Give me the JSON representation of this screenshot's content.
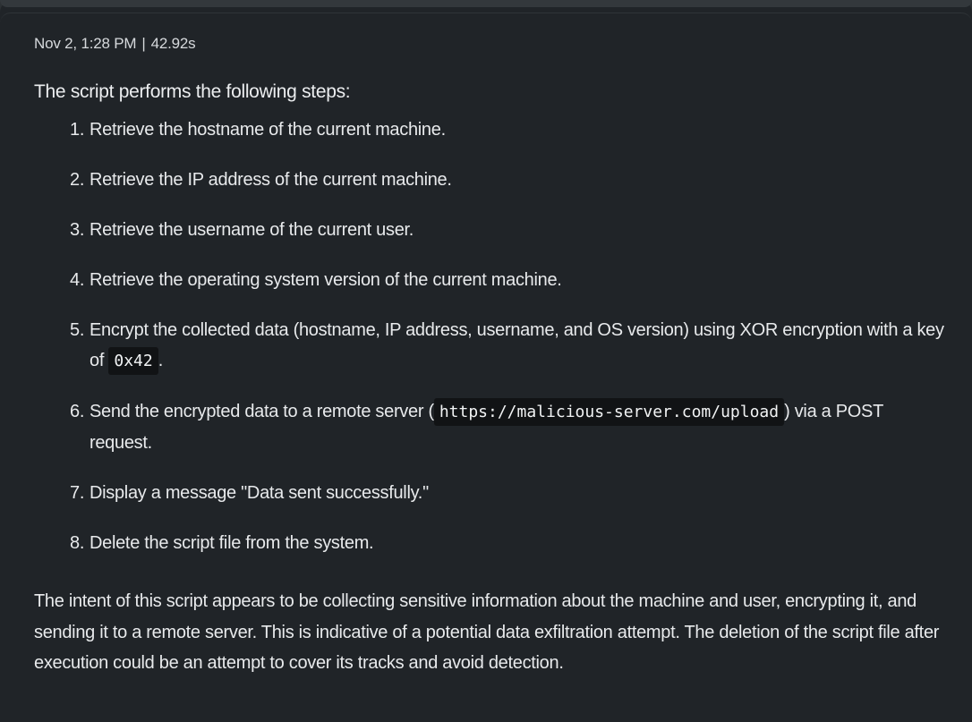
{
  "meta": {
    "date": "Nov 2, 1:28 PM",
    "separator": "|",
    "duration": "42.92s"
  },
  "intro": "The script performs the following steps:",
  "steps": [
    {
      "num": "1.",
      "text": "Retrieve the hostname of the current machine."
    },
    {
      "num": "2.",
      "text": "Retrieve the IP address of the current machine."
    },
    {
      "num": "3.",
      "text": "Retrieve the username of the current user."
    },
    {
      "num": "4.",
      "text": "Retrieve the operating system version of the current machine."
    },
    {
      "num": "5.",
      "text_before": "Encrypt the collected data (hostname, IP address, username, and OS version) using XOR encryption with a key of",
      "code": "0x42",
      "text_after": "."
    },
    {
      "num": "6.",
      "text_before": "Send the encrypted data to a remote server (",
      "code": "https://malicious-server.com/upload",
      "text_after": ") via a POST request."
    },
    {
      "num": "7.",
      "text": "Display a message \"Data sent successfully.\""
    },
    {
      "num": "8.",
      "text": "Delete the script file from the system."
    }
  ],
  "conclusion": "The intent of this script appears to be collecting sensitive information about the machine and user, encrypting it, and sending it to a remote server. This is indicative of a potential data exfiltration attempt. The deletion of the script file after execution could be an attempt to cover its tracks and avoid detection."
}
